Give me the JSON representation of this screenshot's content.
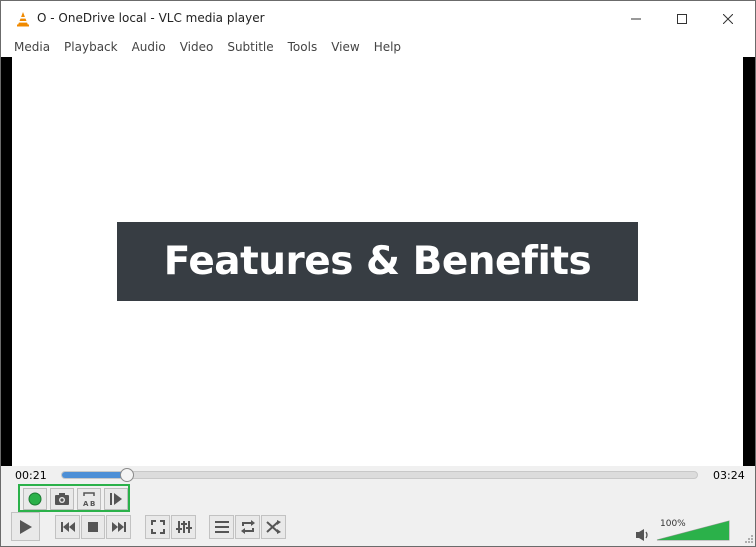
{
  "window": {
    "title": "O - OneDrive local - VLC media player",
    "icons": {
      "app": "vlc-cone-icon",
      "minimize": "minimize-icon",
      "maximize": "maximize-icon",
      "close": "close-icon"
    }
  },
  "menubar": {
    "items": [
      "Media",
      "Playback",
      "Audio",
      "Video",
      "Subtitle",
      "Tools",
      "View",
      "Help"
    ]
  },
  "video": {
    "banner_text": "Features & Benefits",
    "banner_color": "#373d43"
  },
  "seek": {
    "elapsed": "00:21",
    "total": "03:24",
    "progress": 0.103,
    "fill_color": "#4d8fd6"
  },
  "advanced_controls": {
    "highlight_color": "#2bb14a",
    "buttons": [
      "record-icon",
      "snapshot-icon",
      "ab-loop-icon",
      "frame-by-frame-icon"
    ]
  },
  "controls": {
    "buttons": [
      "play-icon",
      "previous-icon",
      "stop-icon",
      "next-icon",
      "fullscreen-icon",
      "extended-settings-icon",
      "playlist-icon",
      "loop-icon",
      "shuffle-icon"
    ]
  },
  "volume": {
    "label": "100%",
    "level": 1.0,
    "color": "#2bb14a"
  }
}
